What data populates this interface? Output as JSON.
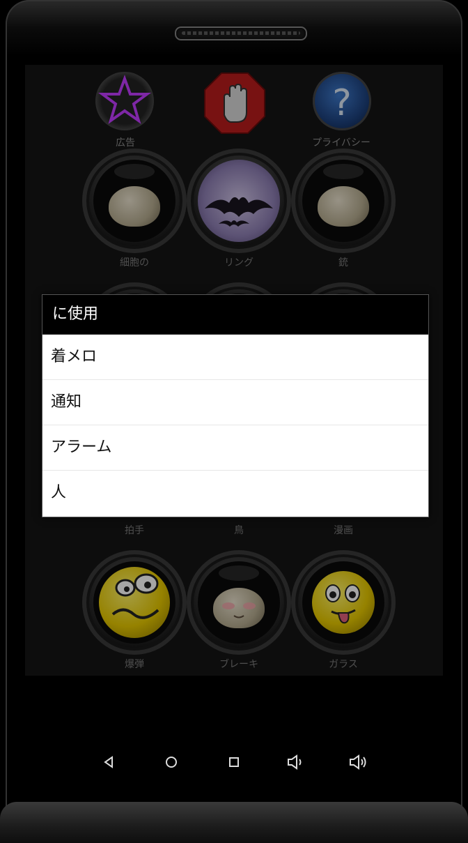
{
  "top_buttons": [
    {
      "icon": "star-icon",
      "label": "広告"
    },
    {
      "icon": "stop-hand-icon",
      "label": ""
    },
    {
      "icon": "question-icon",
      "label": "プライバシー"
    }
  ],
  "sounds_row1": [
    {
      "icon": "blob-smile-icon",
      "label": "細胞の"
    },
    {
      "icon": "bat-moon-icon",
      "label": "リング"
    },
    {
      "icon": "blob-sleep-icon",
      "label": "銃"
    }
  ],
  "sounds_row3_labels": [
    "拍手",
    "鳥",
    "漫画"
  ],
  "sounds_row4": [
    {
      "icon": "smiley-wavy-icon",
      "label": "爆弾"
    },
    {
      "icon": "blob-blush-icon",
      "label": "ブレーキ"
    },
    {
      "icon": "smiley-tongue-icon",
      "label": "ガラス"
    }
  ],
  "dialog": {
    "title": "に使用",
    "items": [
      "着メロ",
      "通知",
      "アラーム",
      "人"
    ]
  },
  "nav": {
    "back": "back-icon",
    "home": "home-icon",
    "recents": "recents-icon",
    "volume_down": "volume-down-icon",
    "volume_up": "volume-up-icon"
  },
  "colors": {
    "dialog_title_bg": "#000000",
    "star_purple": "#c23cff",
    "stop_red": "#c62020",
    "question_blue": "#2a5ea8"
  }
}
